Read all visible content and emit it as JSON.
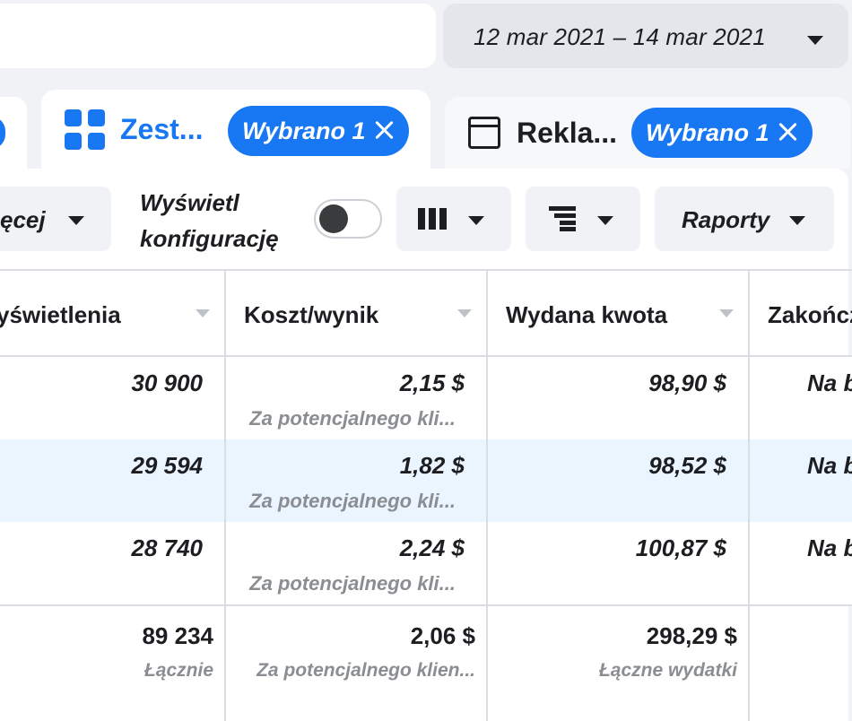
{
  "date_range": "12 mar 2021 – 14 mar 2021",
  "tabs": {
    "adsets": {
      "label": "Zest...",
      "badge": "Wybrano 1"
    },
    "ads": {
      "label": "Rekla...",
      "badge": "Wybrano 1"
    }
  },
  "toolbar": {
    "more_label": "ęcej",
    "toggle_label_line1": "Wyświetl",
    "toggle_label_line2": "konfigurację",
    "reports_label": "Raporty"
  },
  "table": {
    "columns": [
      "yświetlenia",
      "Koszt/wynik",
      "Wydana kwota",
      "Zakończ"
    ],
    "rows": [
      {
        "impressions": "30 900",
        "cost": "2,15 $",
        "cost_sub": "Za potencjalnego kli...",
        "spent": "98,90 $",
        "ends": "Na b"
      },
      {
        "impressions": "29 594",
        "cost": "1,82 $",
        "cost_sub": "Za potencjalnego kli...",
        "spent": "98,52 $",
        "ends": "Na b"
      },
      {
        "impressions": "28 740",
        "cost": "2,24 $",
        "cost_sub": "Za potencjalnego kli...",
        "spent": "100,87 $",
        "ends": "Na b"
      }
    ],
    "totals": {
      "impressions": "89 234",
      "impressions_sub": "Łącznie",
      "cost": "2,06 $",
      "cost_sub": "Za potencjalnego klien...",
      "spent": "298,29 $",
      "spent_sub": "Łączne wydatki"
    }
  },
  "colors": {
    "accent": "#1877f2",
    "row_highlight": "#ebf5ff"
  }
}
